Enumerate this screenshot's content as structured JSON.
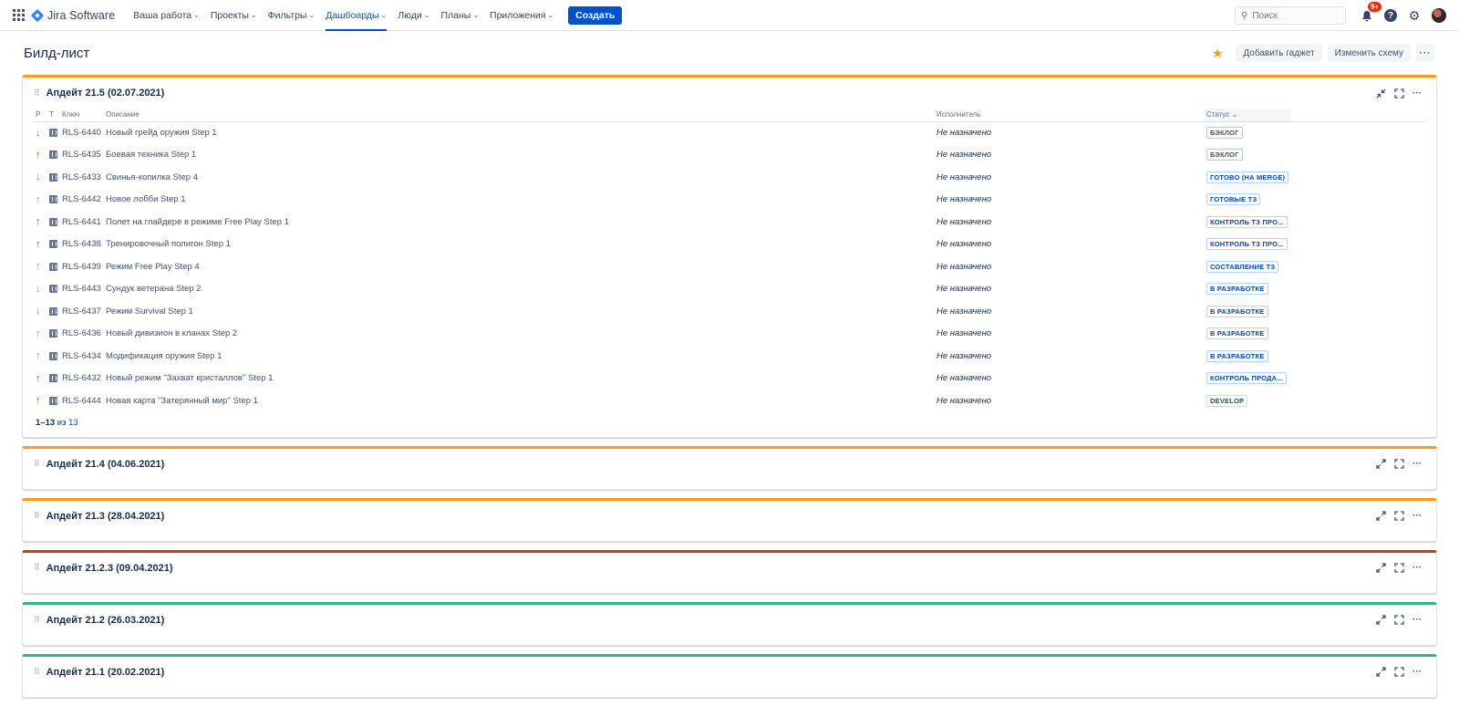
{
  "nav": {
    "product": "Jira Software",
    "items": [
      "Ваша работа",
      "Проекты",
      "Фильтры",
      "Дашбоарды",
      "Люди",
      "Планы",
      "Приложения"
    ],
    "create": "Создать",
    "search_placeholder": "Поиск",
    "notif_badge": "9+",
    "help_glyph": "?"
  },
  "page": {
    "title": "Билд-лист",
    "add_gadget": "Добавить гаджет",
    "edit_layout": "Изменить схему",
    "more": "···"
  },
  "main_gadget": {
    "title": "Апдейт 21.5 (02.07.2021)",
    "color": "#ff991f",
    "columns": {
      "p": "P",
      "t": "T",
      "key": "Ключ",
      "desc": "Описание",
      "assignee": "Исполнитель",
      "status": "Статус"
    },
    "rows": [
      {
        "priority": "low",
        "arrow": "↓",
        "key": "RLS-6440",
        "summary": "Новый грейд оружия Step 1",
        "assignee": "Не назначено",
        "status": "БЭКЛОГ",
        "status_color": "grey"
      },
      {
        "priority": "high",
        "arrow": "↑",
        "key": "RLS-6435",
        "summary": "Боевая техника Step 1",
        "assignee": "Не назначено",
        "status": "БЭКЛОГ",
        "status_color": "grey"
      },
      {
        "priority": "low",
        "arrow": "↓",
        "key": "RLS-6433",
        "summary": "Свинья-копилка Step 4",
        "assignee": "Не назначено",
        "status": "ГОТОВО (НА MERGE)",
        "status_color": "blue"
      },
      {
        "priority": "med",
        "arrow": "↑",
        "key": "RLS-6442",
        "summary": "Новое лобби Step 1",
        "assignee": "Не назначено",
        "status": "ГОТОВЫЕ ТЗ",
        "status_color": "blue"
      },
      {
        "priority": "high",
        "arrow": "↑",
        "key": "RLS-6441",
        "summary": "Полет на глайдере в режиме Free Play Step 1",
        "assignee": "Не назначено",
        "status": "КОНТРОЛЬ ТЗ ПРО...",
        "status_color": "blue"
      },
      {
        "priority": "high",
        "arrow": "↑",
        "key": "RLS-6438",
        "summary": "Тренировочный полигон Step 1",
        "assignee": "Не назначено",
        "status": "КОНТРОЛЬ ТЗ ПРО...",
        "status_color": "blue"
      },
      {
        "priority": "med",
        "arrow": "↑",
        "key": "RLS-6439",
        "summary": "Режим Free Play Step 4",
        "assignee": "Не назначено",
        "status": "СОСТАВЛЕНИЕ ТЗ",
        "status_color": "blue"
      },
      {
        "priority": "low",
        "arrow": "↓",
        "key": "RLS-6443",
        "summary": "Сундук ветерана Step 2",
        "assignee": "Не назначено",
        "status": "В РАЗРАБОТКЕ",
        "status_color": "blue"
      },
      {
        "priority": "low",
        "arrow": "↓",
        "key": "RLS-6437",
        "summary": "Режим Survival Step 1",
        "assignee": "Не назначено",
        "status": "В РАЗРАБОТКЕ",
        "status_color": "blue"
      },
      {
        "priority": "med",
        "arrow": "↑",
        "key": "RLS-6436",
        "summary": "Новый дивизион в кланах Step 2",
        "assignee": "Не назначено",
        "status": "В РАЗРАБОТКЕ",
        "status_color": "blue"
      },
      {
        "priority": "med",
        "arrow": "↑",
        "key": "RLS-6434",
        "summary": "Модификация оружия Step 1",
        "assignee": "Не назначено",
        "status": "В РАЗРАБОТКЕ",
        "status_color": "blue"
      },
      {
        "priority": "high",
        "arrow": "↑",
        "key": "RLS-6432",
        "summary": "Новый режим \"Захват кристаллов\" Step 1",
        "assignee": "Не назначено",
        "status": "КОНТРОЛЬ ПРОДА...",
        "status_color": "blue"
      },
      {
        "priority": "high",
        "arrow": "↑",
        "key": "RLS-6444",
        "summary": "Новая карта \"Затерянный мир\" Step 1",
        "assignee": "Не назначено",
        "status": "DEVELOP",
        "status_color": "green"
      }
    ],
    "pagination": {
      "range": "1–13",
      "of": "из",
      "total": "13"
    }
  },
  "collapsed_gadgets": [
    {
      "title": "Апдейт 21.4 (04.06.2021)",
      "color": "#ff991f"
    },
    {
      "title": "Апдейт 21.3 (28.04.2021)",
      "color": "#ff991f"
    },
    {
      "title": "Апдейт 21.2.3 (09.04.2021)",
      "color": "#de350b"
    },
    {
      "title": "Апдейт 21.2 (26.03.2021)",
      "color": "#36b37e"
    },
    {
      "title": "Апдейт 21.1 (20.02.2021)",
      "color": "#36b37e"
    }
  ]
}
